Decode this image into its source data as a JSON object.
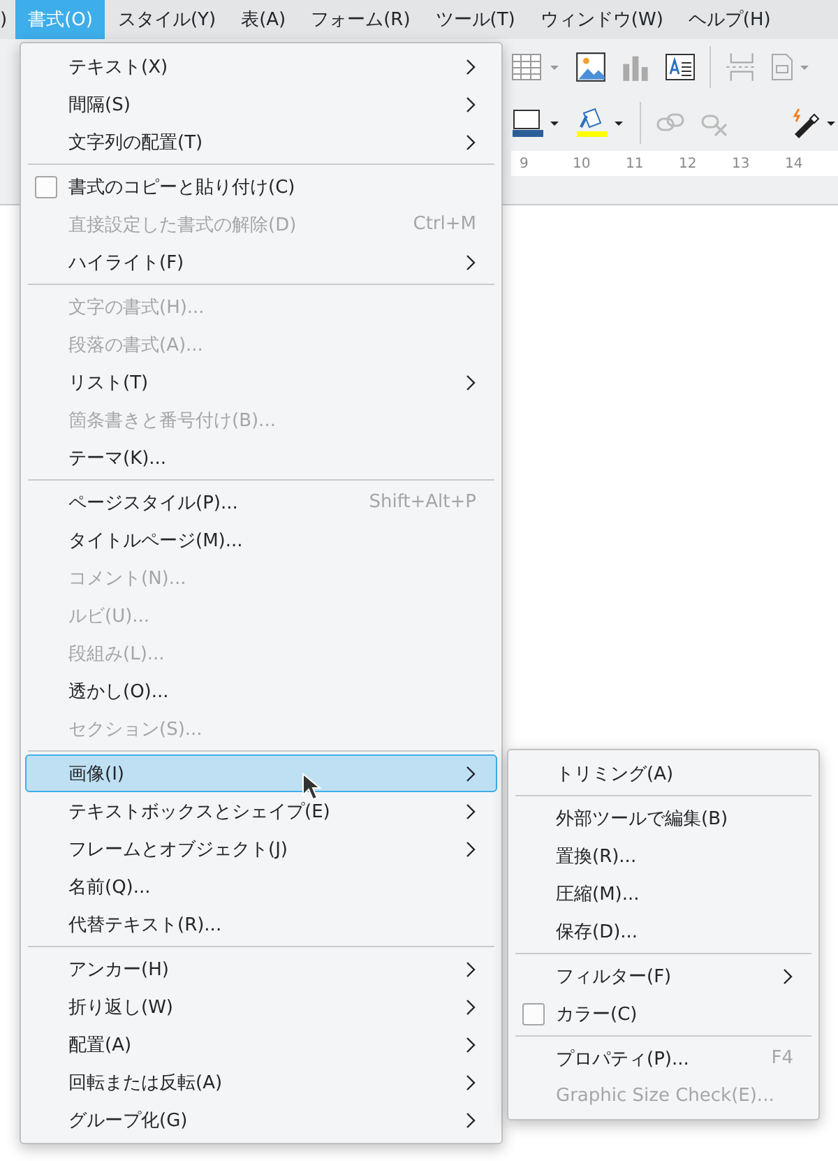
{
  "menubar": [
    {
      "label": ")",
      "selected": false
    },
    {
      "label": "書式(O)",
      "selected": true
    },
    {
      "label": "スタイル(Y)",
      "selected": false
    },
    {
      "label": "表(A)",
      "selected": false
    },
    {
      "label": "フォーム(R)",
      "selected": false
    },
    {
      "label": "ツール(T)",
      "selected": false
    },
    {
      "label": "ウィンドウ(W)",
      "selected": false
    },
    {
      "label": "ヘルプ(H)",
      "selected": false
    }
  ],
  "ruler": {
    "marks": [
      "9",
      "10",
      "11",
      "12",
      "13",
      "14"
    ]
  },
  "menu": {
    "groups": [
      {
        "items": [
          {
            "kind": "submenu",
            "label": "テキスト(X)",
            "disabled": false,
            "highlighted": false
          },
          {
            "kind": "submenu",
            "label": "間隔(S)",
            "disabled": false,
            "highlighted": false
          },
          {
            "kind": "submenu",
            "label": "文字列の配置(T)",
            "disabled": false,
            "highlighted": false
          }
        ]
      },
      {
        "items": [
          {
            "kind": "check",
            "label": "書式のコピーと貼り付け(C)",
            "checked": false,
            "disabled": false,
            "highlighted": false
          },
          {
            "kind": "item",
            "label": "直接設定した書式の解除(D)",
            "shortcut": "Ctrl+M",
            "disabled": true,
            "highlighted": false
          },
          {
            "kind": "submenu",
            "label": "ハイライト(F)",
            "disabled": false,
            "highlighted": false
          }
        ]
      },
      {
        "items": [
          {
            "kind": "item",
            "label": "文字の書式(H)...",
            "disabled": true,
            "highlighted": false
          },
          {
            "kind": "item",
            "label": "段落の書式(A)...",
            "disabled": true,
            "highlighted": false
          },
          {
            "kind": "submenu",
            "label": "リスト(T)",
            "disabled": false,
            "highlighted": false
          },
          {
            "kind": "item",
            "label": "箇条書きと番号付け(B)...",
            "disabled": true,
            "highlighted": false
          },
          {
            "kind": "item",
            "label": "テーマ(K)...",
            "disabled": false,
            "highlighted": false
          }
        ]
      },
      {
        "items": [
          {
            "kind": "item",
            "label": "ページスタイル(P)...",
            "shortcut": "Shift+Alt+P",
            "disabled": false,
            "highlighted": false
          },
          {
            "kind": "item",
            "label": "タイトルページ(M)...",
            "disabled": false,
            "highlighted": false
          },
          {
            "kind": "item",
            "label": "コメント(N)...",
            "disabled": true,
            "highlighted": false
          },
          {
            "kind": "item",
            "label": "ルビ(U)...",
            "disabled": true,
            "highlighted": false
          },
          {
            "kind": "item",
            "label": "段組み(L)...",
            "disabled": true,
            "highlighted": false
          },
          {
            "kind": "item",
            "label": "透かし(O)...",
            "disabled": false,
            "highlighted": false
          },
          {
            "kind": "item",
            "label": "セクション(S)...",
            "disabled": true,
            "highlighted": false
          }
        ]
      },
      {
        "items": [
          {
            "kind": "submenu",
            "label": "画像(I)",
            "disabled": false,
            "highlighted": true
          },
          {
            "kind": "submenu",
            "label": "テキストボックスとシェイプ(E)",
            "disabled": false,
            "highlighted": false
          },
          {
            "kind": "submenu",
            "label": "フレームとオブジェクト(J)",
            "disabled": false,
            "highlighted": false
          },
          {
            "kind": "item",
            "label": "名前(Q)...",
            "disabled": false,
            "highlighted": false
          },
          {
            "kind": "item",
            "label": "代替テキスト(R)...",
            "disabled": false,
            "highlighted": false
          }
        ]
      },
      {
        "items": [
          {
            "kind": "submenu",
            "label": "アンカー(H)",
            "disabled": false,
            "highlighted": false
          },
          {
            "kind": "submenu",
            "label": "折り返し(W)",
            "disabled": false,
            "highlighted": false
          },
          {
            "kind": "submenu",
            "label": "配置(A)",
            "disabled": false,
            "highlighted": false
          },
          {
            "kind": "submenu",
            "label": "回転または反転(A)",
            "disabled": false,
            "highlighted": false
          },
          {
            "kind": "submenu",
            "label": "グループ化(G)",
            "disabled": false,
            "highlighted": false
          }
        ]
      }
    ]
  },
  "submenu": {
    "groups": [
      {
        "items": [
          {
            "kind": "item",
            "label": "トリミング(A)",
            "disabled": false,
            "highlighted": false
          }
        ]
      },
      {
        "items": [
          {
            "kind": "item",
            "label": "外部ツールで編集(B)",
            "disabled": false,
            "highlighted": false
          },
          {
            "kind": "item",
            "label": "置換(R)...",
            "disabled": false,
            "highlighted": false
          },
          {
            "kind": "item",
            "label": "圧縮(M)...",
            "disabled": false,
            "highlighted": false
          },
          {
            "kind": "item",
            "label": "保存(D)...",
            "disabled": false,
            "highlighted": false
          }
        ]
      },
      {
        "items": [
          {
            "kind": "submenu",
            "label": "フィルター(F)",
            "disabled": false,
            "highlighted": false
          },
          {
            "kind": "check",
            "label": "カラー(C)",
            "checked": false,
            "disabled": false,
            "highlighted": false
          }
        ]
      },
      {
        "items": [
          {
            "kind": "item",
            "label": "プロパティ(P)...",
            "shortcut": "F4",
            "disabled": false,
            "highlighted": false
          },
          {
            "kind": "item",
            "label": "Graphic Size Check(E)...",
            "disabled": true,
            "highlighted": false
          }
        ]
      }
    ]
  }
}
